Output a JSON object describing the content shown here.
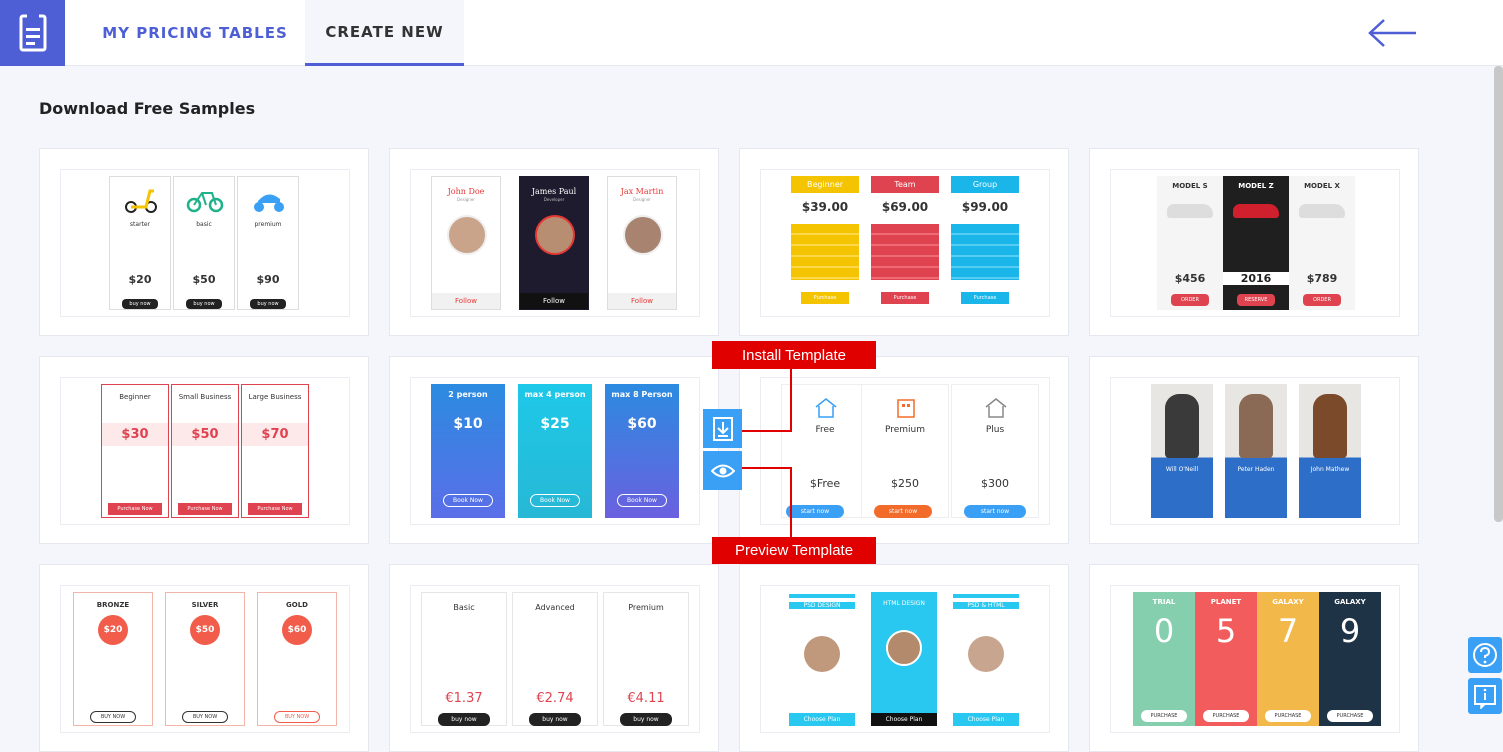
{
  "tabs": {
    "my_pricing_tables": "MY PRICING TABLES",
    "create_new": "CREATE NEW"
  },
  "heading": "Download Free Samples",
  "overlay": {
    "install_label": "Install Template",
    "preview_label": "Preview Template"
  },
  "colors": {
    "brand": "#4e5fd6",
    "action_blue": "#3aa0f5",
    "callout_red": "#e00000"
  },
  "samples": {
    "s1": {
      "plans": [
        {
          "name": "starter",
          "price": "$20",
          "cta": "buy now"
        },
        {
          "name": "basic",
          "price": "$50",
          "cta": "buy now"
        },
        {
          "name": "premium",
          "price": "$90",
          "cta": "buy now"
        }
      ]
    },
    "s2": {
      "plans": [
        {
          "name": "John Doe",
          "role": "Designer",
          "cta": "Follow"
        },
        {
          "name": "James Paul",
          "role": "Developer",
          "cta": "Follow"
        },
        {
          "name": "Jax Martin",
          "role": "Designer",
          "cta": "Follow"
        }
      ]
    },
    "s3": {
      "plans": [
        {
          "name": "Beginner",
          "price": "$39.00",
          "cta": "Purchase"
        },
        {
          "name": "Team",
          "price": "$69.00",
          "cta": "Purchase"
        },
        {
          "name": "Group",
          "price": "$99.00",
          "cta": "Purchase"
        }
      ]
    },
    "s4": {
      "plans": [
        {
          "name": "MODEL S",
          "price": "$456",
          "cta": "ORDER"
        },
        {
          "name": "MODEL Z",
          "price": "2016",
          "cta": "RESERVE"
        },
        {
          "name": "MODEL X",
          "price": "$789",
          "cta": "ORDER"
        }
      ]
    },
    "s5": {
      "plans": [
        {
          "name": "Beginner",
          "price": "$30",
          "cta": "Purchase Now"
        },
        {
          "name": "Small Business",
          "price": "$50",
          "cta": "Purchase Now"
        },
        {
          "name": "Large Business",
          "price": "$70",
          "cta": "Purchase Now"
        }
      ]
    },
    "s6": {
      "plans": [
        {
          "name": "2 person",
          "price": "$10",
          "cta": "Book Now"
        },
        {
          "name": "max 4 person",
          "price": "$25",
          "cta": "Book Now"
        },
        {
          "name": "max 8 Person",
          "price": "$60",
          "cta": "Book Now"
        }
      ]
    },
    "s7": {
      "plans": [
        {
          "name": "Free",
          "price": "$Free",
          "cta": "start now"
        },
        {
          "name": "Premium",
          "price": "$250",
          "cta": "start now"
        },
        {
          "name": "Plus",
          "price": "$300",
          "cta": "start now"
        }
      ]
    },
    "s8": {
      "plans": [
        {
          "name": "Will O'Neill"
        },
        {
          "name": "Peter Haden"
        },
        {
          "name": "John Mathew"
        }
      ]
    },
    "s9": {
      "plans": [
        {
          "name": "BRONZE",
          "price": "$20",
          "cta": "BUY NOW"
        },
        {
          "name": "SILVER",
          "price": "$50",
          "cta": "BUY NOW"
        },
        {
          "name": "GOLD",
          "price": "$60",
          "cta": "BUY NOW"
        }
      ]
    },
    "s10": {
      "plans": [
        {
          "name": "Basic",
          "price": "€1.37",
          "cta": "buy now"
        },
        {
          "name": "Advanced",
          "price": "€2.74",
          "cta": "buy now"
        },
        {
          "name": "Premium",
          "price": "€4.11",
          "cta": "buy now"
        }
      ]
    },
    "s11": {
      "plans": [
        {
          "name": "PSD DESIGN",
          "cta": "Choose Plan"
        },
        {
          "name": "HTML DESIGN",
          "cta": "Choose Plan"
        },
        {
          "name": "PSD & HTML",
          "cta": "Choose Plan"
        }
      ]
    },
    "s12": {
      "plans": [
        {
          "name": "TRIAL",
          "price": "0",
          "cta": "PURCHASE"
        },
        {
          "name": "PLANET",
          "price": "5",
          "cta": "PURCHASE"
        },
        {
          "name": "GALAXY",
          "price": "7",
          "cta": "PURCHASE"
        },
        {
          "name": "GALAXY",
          "price": "9",
          "cta": "PURCHASE"
        }
      ]
    }
  }
}
